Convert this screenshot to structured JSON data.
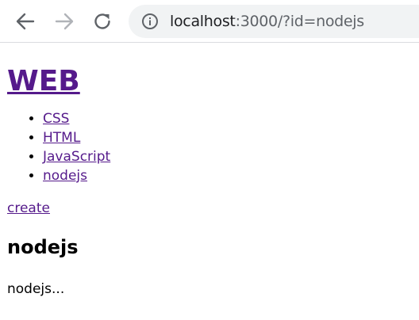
{
  "browser": {
    "url_host": "localhost",
    "url_rest": ":3000/?id=nodejs",
    "back_icon": "back-arrow-icon",
    "forward_icon": "forward-arrow-icon",
    "reload_icon": "reload-icon",
    "info_icon": "info-icon"
  },
  "page": {
    "title": "WEB",
    "nav_items": [
      {
        "label": "CSS"
      },
      {
        "label": "HTML"
      },
      {
        "label": "JavaScript"
      },
      {
        "label": "nodejs"
      }
    ],
    "create_label": "create",
    "heading": "nodejs",
    "description": "nodejs..."
  },
  "colors": {
    "visited_link": "#551a8b",
    "omnibox_bg": "#f1f3f4"
  }
}
